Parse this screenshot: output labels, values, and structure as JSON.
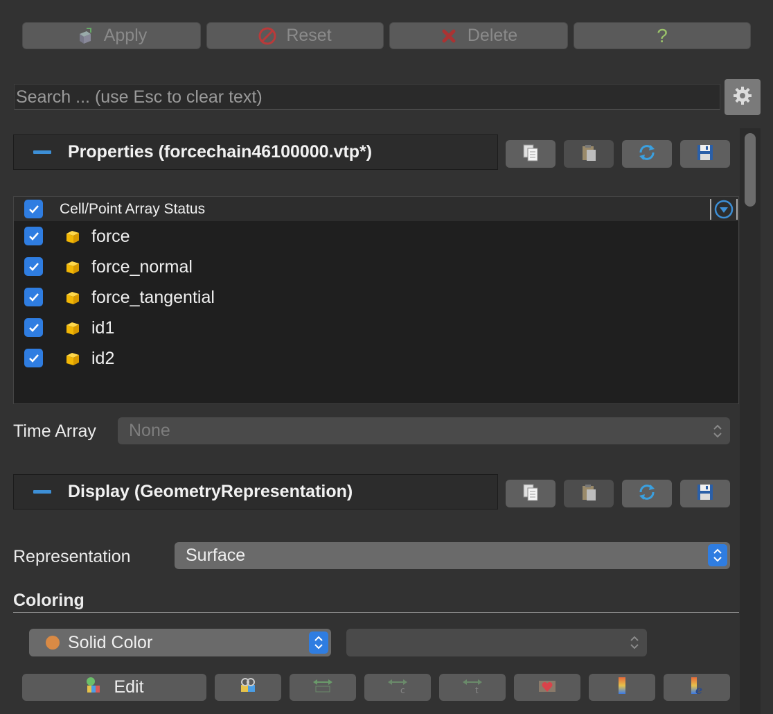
{
  "toolbar": {
    "apply_label": "Apply",
    "reset_label": "Reset",
    "delete_label": "Delete",
    "help_label": "?"
  },
  "search": {
    "placeholder": "Search ... (use Esc to clear text)"
  },
  "properties": {
    "title": "Properties (forcechain46100000.vtp*)",
    "array_header": "Cell/Point Array Status",
    "arrays": [
      {
        "name": "force",
        "checked": true
      },
      {
        "name": "force_normal",
        "checked": true
      },
      {
        "name": "force_tangential",
        "checked": true
      },
      {
        "name": "id1",
        "checked": true
      },
      {
        "name": "id2",
        "checked": true
      }
    ],
    "time_array_label": "Time Array",
    "time_array_value": "None"
  },
  "display": {
    "title": "Display (GeometryRepresentation)",
    "representation_label": "Representation",
    "representation_value": "Surface",
    "coloring_label": "Coloring",
    "coloring_value": "Solid Color",
    "coloring_component_value": "",
    "edit_label": "Edit"
  },
  "colors": {
    "accent": "#2f7de1",
    "section_minus": "#3d8fd6",
    "solid_color_swatch": "#d98a45",
    "background": "#323232"
  }
}
